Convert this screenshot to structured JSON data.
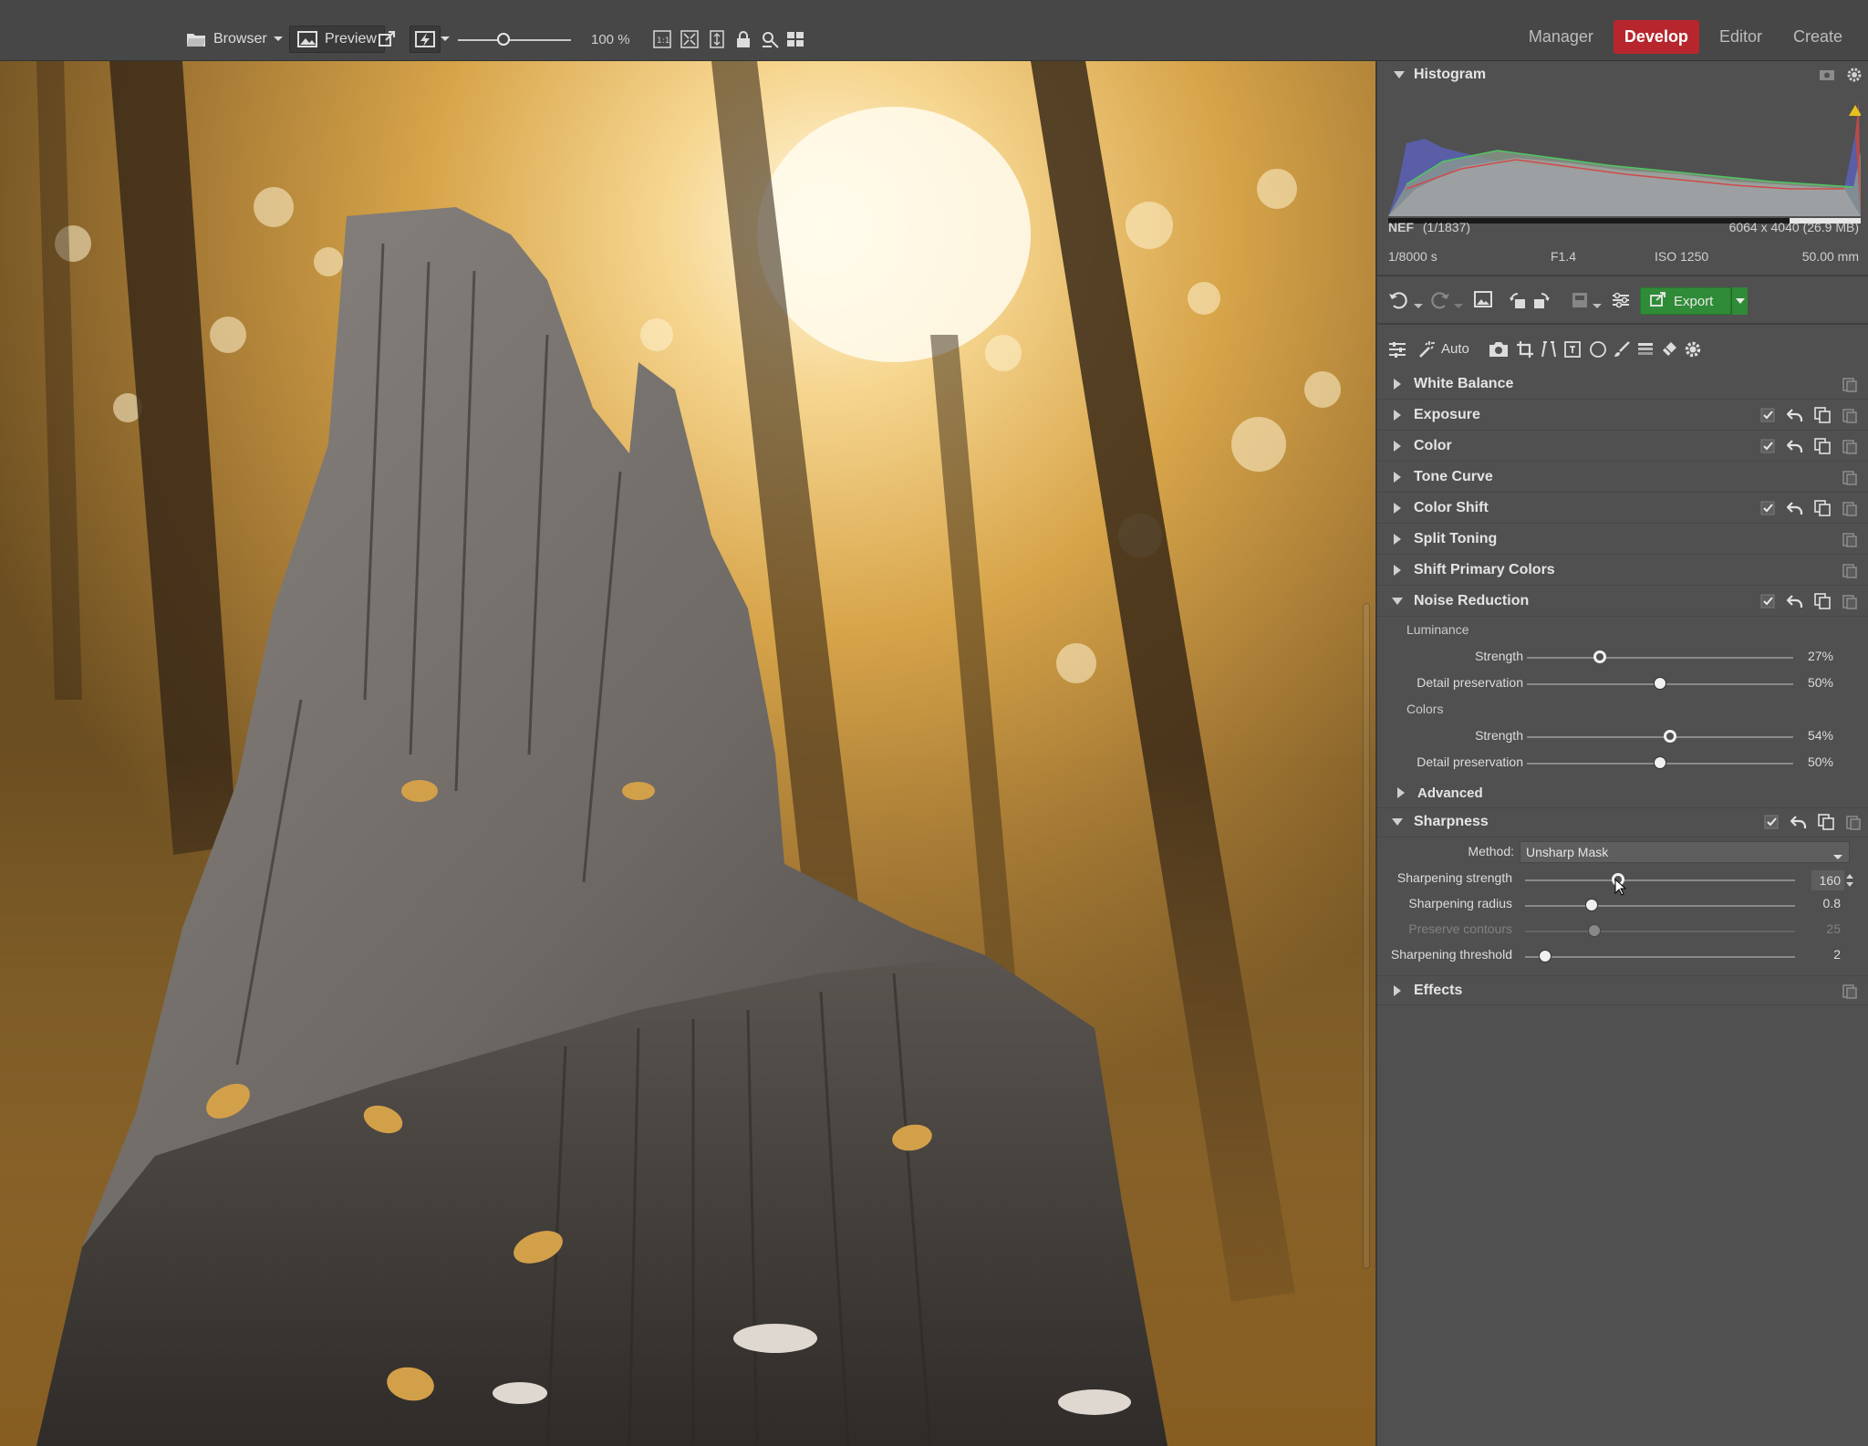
{
  "toolbar": {
    "browser_label": "Browser",
    "preview_label": "Preview",
    "zoom_value": "100 %",
    "zoom_level": 0.35
  },
  "modes": [
    "Manager",
    "Develop",
    "Editor",
    "Create"
  ],
  "active_mode": "Develop",
  "histogram": {
    "title": "Histogram",
    "file_type": "NEF",
    "file_index": "(1/1837)",
    "dimensions": "6064 x 4040 (26.9 MB)",
    "shutter": "1/8000 s",
    "aperture": "F1.4",
    "iso": "ISO 1250",
    "focal": "50.00 mm"
  },
  "actions": {
    "export_label": "Export"
  },
  "tools": {
    "auto_label": "Auto"
  },
  "sections": {
    "white_balance": "White Balance",
    "exposure": "Exposure",
    "color": "Color",
    "tone_curve": "Tone Curve",
    "color_shift": "Color Shift",
    "split_toning": "Split Toning",
    "shift_primary": "Shift Primary Colors",
    "noise_reduction": "Noise Reduction",
    "sharpness": "Sharpness",
    "effects": "Effects"
  },
  "noise": {
    "luminance_label": "Luminance",
    "lum_strength_label": "Strength",
    "lum_strength_value": "27%",
    "lum_detail_label": "Detail preservation",
    "lum_detail_value": "50%",
    "colors_label": "Colors",
    "col_strength_label": "Strength",
    "col_strength_value": "54%",
    "col_detail_label": "Detail preservation",
    "col_detail_value": "50%",
    "advanced_label": "Advanced"
  },
  "sharpness": {
    "method_label": "Method:",
    "method_value": "Unsharp Mask",
    "strength_label": "Sharpening strength",
    "strength_value": "160",
    "radius_label": "Sharpening radius",
    "radius_value": "0.8",
    "contours_label": "Preserve contours",
    "contours_value": "25",
    "threshold_label": "Sharpening threshold",
    "threshold_value": "2"
  }
}
